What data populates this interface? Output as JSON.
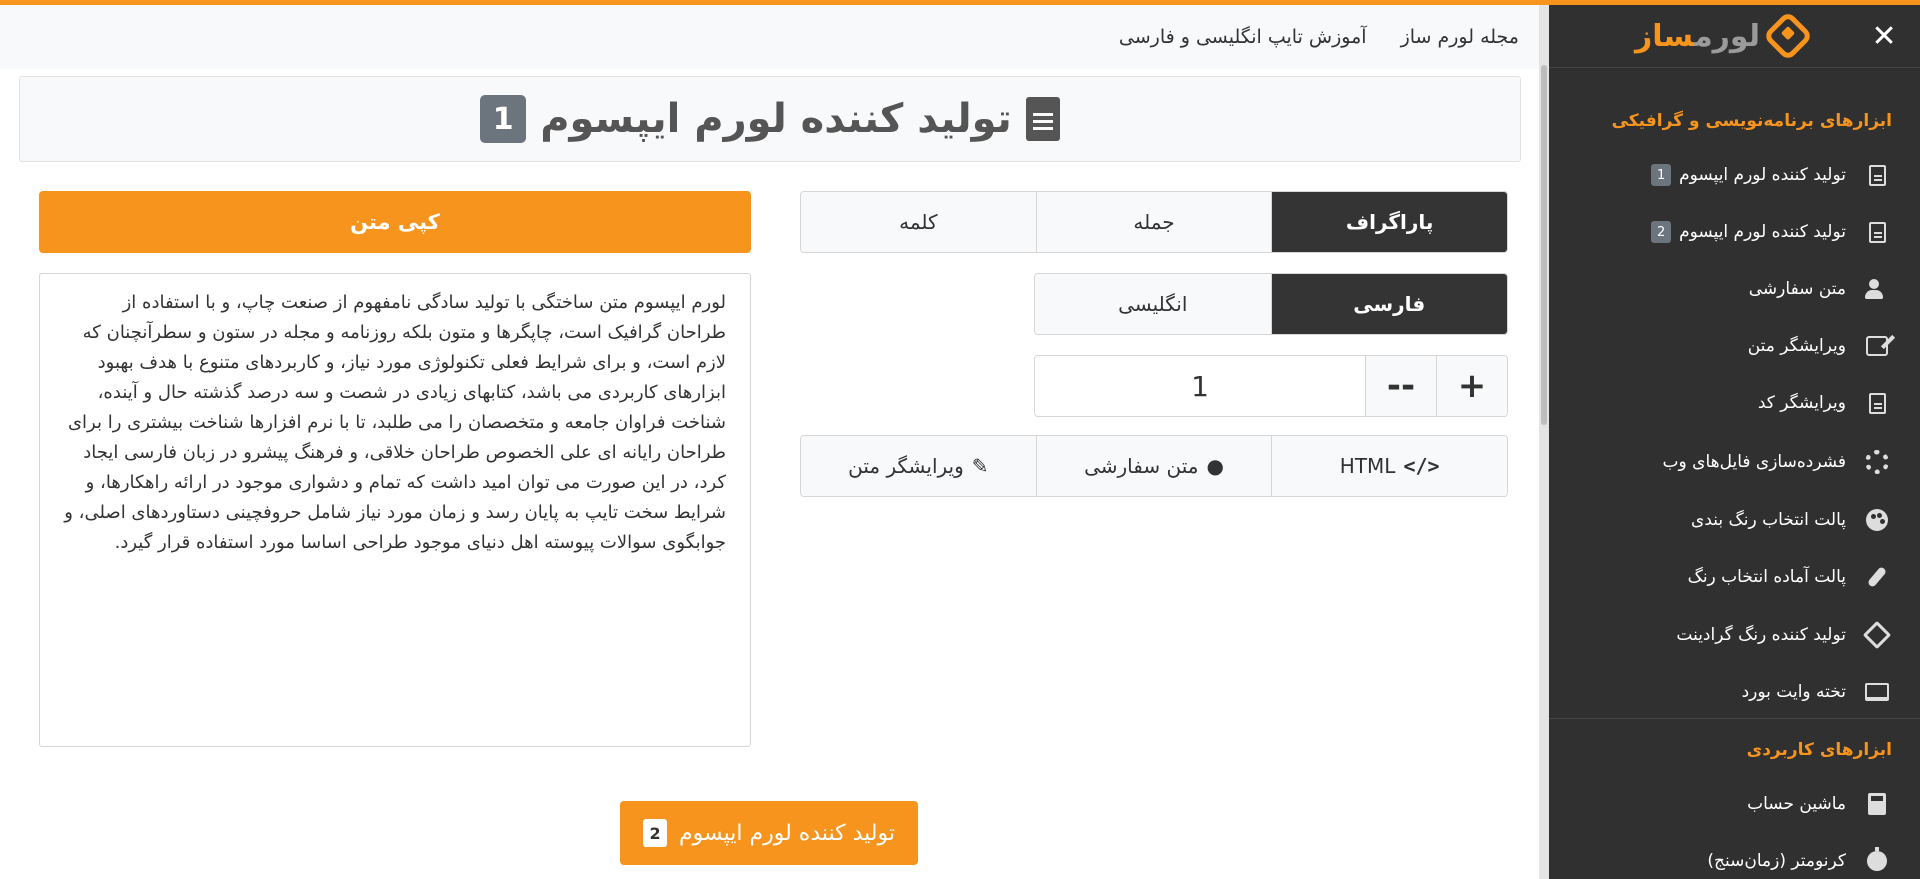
{
  "topnav": {
    "link_magazine": "مجله لورم ساز",
    "link_typing": "آموزش تایپ انگلیسی و فارسی"
  },
  "logo": {
    "text_gray": "لورم",
    "text_orange": "ساز"
  },
  "title": {
    "text": "تولید کننده لورم ایپسوم",
    "badge": "1"
  },
  "mode_tabs": [
    {
      "label": "پاراگراف",
      "active": true
    },
    {
      "label": "جمله",
      "active": false
    },
    {
      "label": "کلمه",
      "active": false
    }
  ],
  "language_tabs": [
    {
      "label": "فارسی",
      "active": true
    },
    {
      "label": "انگلیسی",
      "active": false
    }
  ],
  "counter": {
    "value": "1",
    "plus": "+",
    "minus": "--"
  },
  "actions": [
    {
      "label": "HTML",
      "icon": "code-icon"
    },
    {
      "label": "متن سفارشی",
      "icon": "user-edit-icon"
    },
    {
      "label": "ویرایشگر متن",
      "icon": "edit-icon"
    }
  ],
  "copy_button": "کپی متن",
  "generated_text": "لورم ایپسوم متن ساختگی با تولید سادگی نامفهوم از صنعت چاپ، و با استفاده از طراحان گرافیک است، چاپگرها و متون بلکه روزنامه و مجله در ستون و سطرآنچنان که لازم است، و برای شرایط فعلی تکنولوژی مورد نیاز، و کاربردهای متنوع با هدف بهبود ابزارهای کاربردی می باشد، کتابهای زیادی در شصت و سه درصد گذشته حال و آینده، شناخت فراوان جامعه و متخصصان را می طلبد، تا با نرم افزارها شناخت بیشتری را برای طراحان رایانه ای علی الخصوص طراحان خلاقی، و فرهنگ پیشرو در زبان فارسی ایجاد کرد، در این صورت می توان امید داشت که تمام و دشواری موجود در ارائه راهکارها، و شرایط سخت تایپ به پایان رسد و زمان مورد نیاز شامل حروفچینی دستاوردهای اصلی، و جوابگوی سوالات پیوسته اهل دنیای موجود طراحی اساسا مورد استفاده قرار گیرد.",
  "generator2_button": {
    "label": "تولید کننده لورم ایپسوم",
    "badge": "2"
  },
  "sidebar": {
    "section1": "ابزارهای برنامه‌نویسی و گرافیکی",
    "items1": [
      {
        "label": "تولید کننده لورم ایپسوم",
        "badge": "1",
        "icon": "document-icon"
      },
      {
        "label": "تولید کننده لورم ایپسوم",
        "badge": "2",
        "icon": "document-icon"
      },
      {
        "label": "متن سفارشی",
        "icon": "user-edit-icon"
      },
      {
        "label": "ویرایشگر متن",
        "icon": "edit-icon"
      },
      {
        "label": "ویرایشگر کد",
        "icon": "code-file-icon"
      },
      {
        "label": "فشرده‌سازی فایل‌های وب",
        "icon": "gears-icon"
      },
      {
        "label": "پالت انتخاب رنگ بندی",
        "icon": "palette-icon"
      },
      {
        "label": "پالت آماده انتخاب رنگ",
        "icon": "brush-icon"
      },
      {
        "label": "تولید کننده رنگ گرادینت",
        "icon": "fill-icon"
      },
      {
        "label": "تخته وایت بورد",
        "icon": "laptop-icon"
      }
    ],
    "section2": "ابزارهای کاربردی",
    "items2": [
      {
        "label": "ماشین حساب",
        "icon": "calculator-icon"
      },
      {
        "label": "کرنومتر (زمان‌سنج)",
        "icon": "stopwatch-icon"
      }
    ]
  },
  "colors": {
    "accent": "#f7941d",
    "sidebar_bg": "#303030",
    "active_tab": "#343434"
  }
}
